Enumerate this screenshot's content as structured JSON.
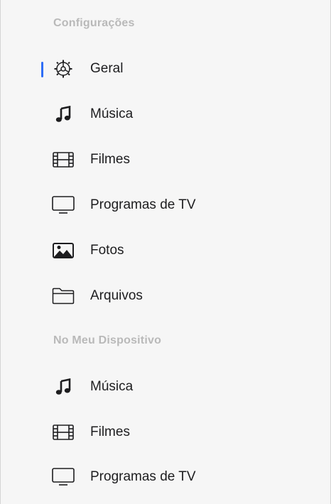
{
  "settings_section": {
    "title": "Configurações",
    "items": [
      {
        "label": "Geral",
        "icon": "gear-icon",
        "selected": true
      },
      {
        "label": "Música",
        "icon": "music-note-icon"
      },
      {
        "label": "Filmes",
        "icon": "film-icon"
      },
      {
        "label": "Programas de TV",
        "icon": "tv-icon"
      },
      {
        "label": "Fotos",
        "icon": "photo-icon"
      },
      {
        "label": "Arquivos",
        "icon": "folder-icon"
      }
    ]
  },
  "device_section": {
    "title": "No Meu Dispositivo",
    "items": [
      {
        "label": "Música",
        "icon": "music-note-icon"
      },
      {
        "label": "Filmes",
        "icon": "film-icon"
      },
      {
        "label": "Programas de TV",
        "icon": "tv-icon"
      }
    ]
  },
  "colors": {
    "accent": "#2f6ef6",
    "section_title": "#b9b9b9",
    "background": "#f6f6f6"
  }
}
